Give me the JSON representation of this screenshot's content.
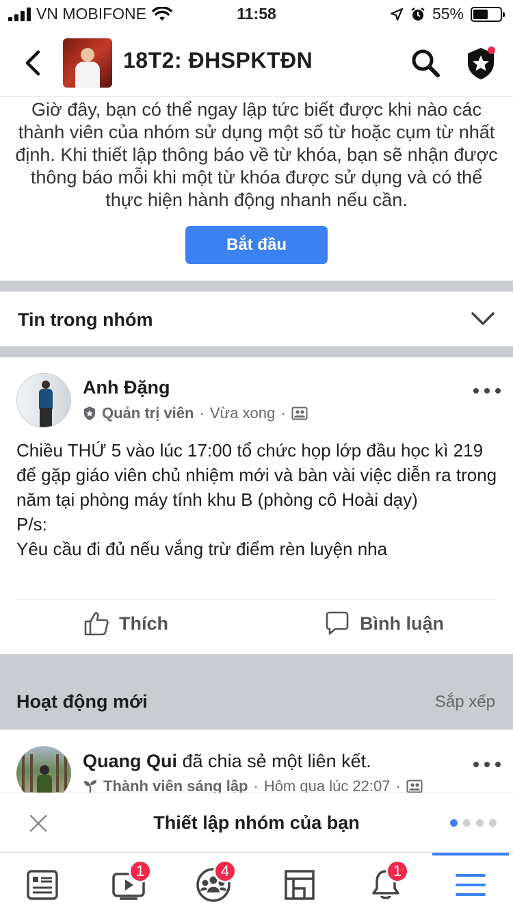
{
  "status_bar": {
    "carrier": "VN MOBIFONE",
    "time": "11:58",
    "battery_percent": "55%",
    "battery_level": 0.55
  },
  "header": {
    "group_name": "18T2: ĐHSPKTĐN"
  },
  "keyword_alerts": {
    "description": "Giờ đây, bạn có thể ngay lập tức biết được khi nào các thành viên của nhóm sử dụng một số từ hoặc cụm từ nhất định. Khi thiết lập thông báo về từ khóa, bạn sẽ nhận được thông báo mỗi khi một từ khóa được sử dụng và có thể thực hiện hành động nhanh nếu cần.",
    "button_label": "Bắt đầu"
  },
  "section": {
    "label": "Tin trong nhóm"
  },
  "post": {
    "author": "Anh Đặng",
    "role": "Quản trị viên",
    "time": "Vừa xong",
    "body_lines": [
      "Chiều THỨ 5 vào lúc 17:00 tổ chức họp lớp đầu học kì 219 để gặp giáo viên chủ nhiệm mới và bàn vài việc diễn ra trong năm tại phòng máy tính khu B (phòng cô Hoài dạy)",
      "P/s:",
      "Yêu cầu đi đủ nếu vắng trừ điểm rèn luyện nha"
    ],
    "like_label": "Thích",
    "comment_label": "Bình luận"
  },
  "activity": {
    "label": "Hoạt động mới",
    "sort_label": "Sắp xếp",
    "item": {
      "author": "Quang Qui",
      "action": "đã chia sẻ một liên kết.",
      "role": "Thành viên sáng lập",
      "time": "Hôm qua lúc 22:07"
    }
  },
  "setup_banner": {
    "title": "Thiết lập nhóm của bạn",
    "page_count": 4,
    "active_page": 1
  },
  "tab_bar": {
    "tabs": [
      {
        "name": "news-feed",
        "badge": ""
      },
      {
        "name": "watch",
        "badge": "1"
      },
      {
        "name": "groups",
        "badge": "4"
      },
      {
        "name": "marketplace",
        "badge": ""
      },
      {
        "name": "notifications",
        "badge": "1"
      },
      {
        "name": "menu",
        "badge": ""
      }
    ]
  },
  "colors": {
    "accent": "#3b82f0",
    "badge": "#f02849",
    "separator": "#c9ccd1"
  }
}
